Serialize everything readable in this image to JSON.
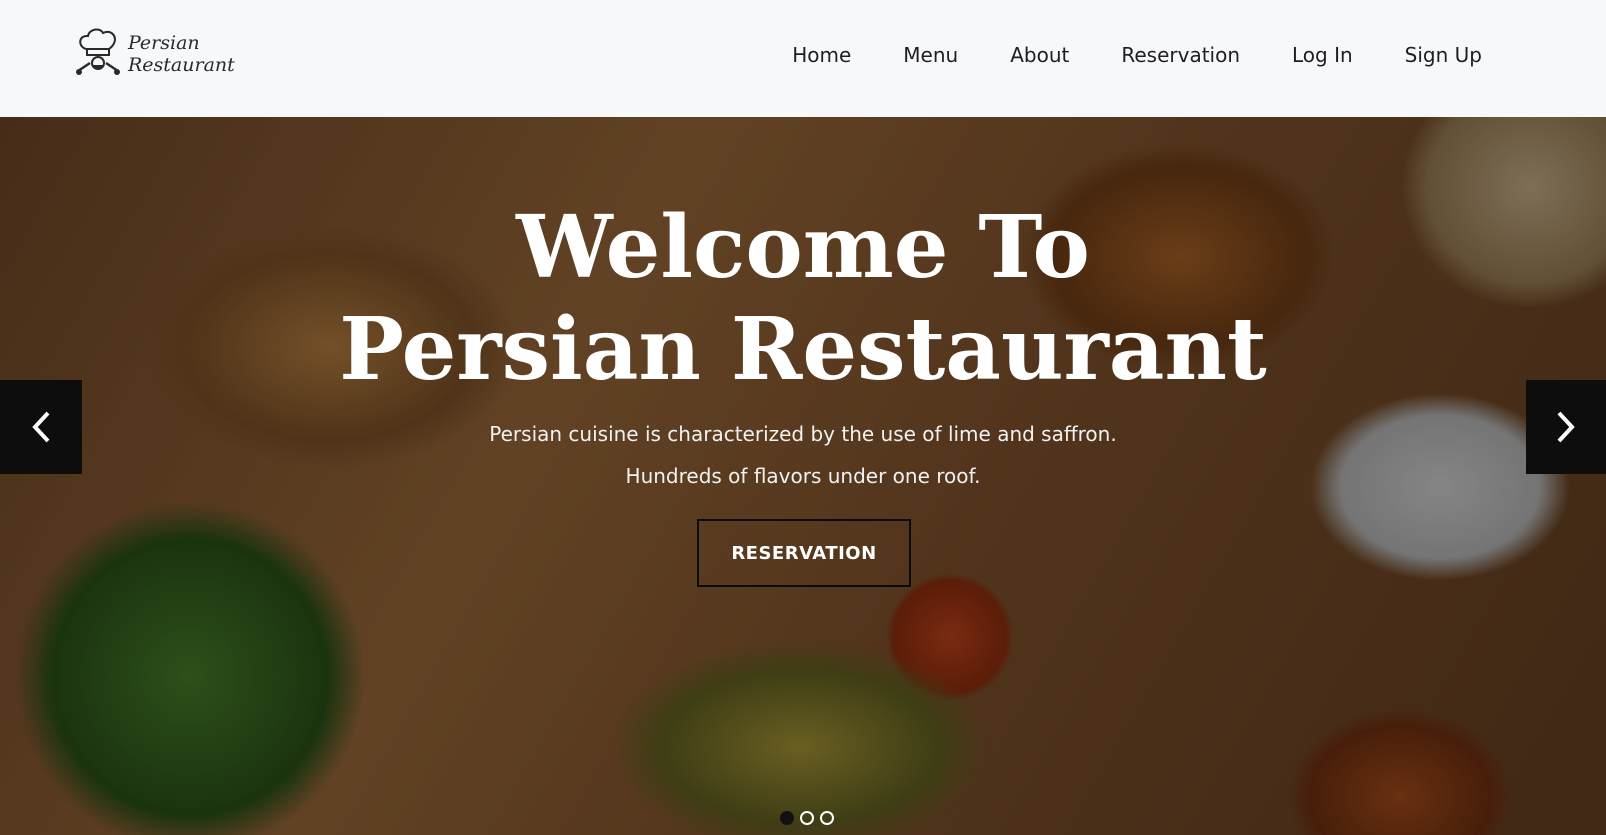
{
  "brand": {
    "logo_icon": "chef-hat-icon",
    "name_line1": "Persian",
    "name_line2": "Restaurant"
  },
  "nav": {
    "items": [
      {
        "label": "Home"
      },
      {
        "label": "Menu"
      },
      {
        "label": "About"
      },
      {
        "label": "Reservation"
      },
      {
        "label": "Log In"
      },
      {
        "label": "Sign Up"
      }
    ]
  },
  "hero": {
    "title_line1": "Welcome To",
    "title_line2": "Persian Restaurant",
    "subtitle_line1": "Persian cuisine is characterized by the use of lime and saffron.",
    "subtitle_line2": "Hundreds of flavors under one roof.",
    "cta_label": "RESERVATION",
    "prev_icon": "chevron-left-icon",
    "next_icon": "chevron-right-icon",
    "slides_count": 3,
    "active_slide": 1
  },
  "colors": {
    "nav_bg": "#f7f8fa",
    "arrow_bg": "#0d0d0d",
    "text_light": "#ffffff"
  }
}
